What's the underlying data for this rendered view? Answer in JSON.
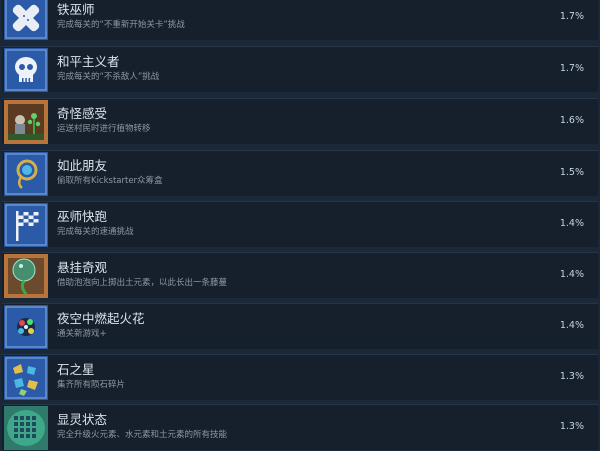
{
  "achievements": [
    {
      "title": "铁巫师",
      "desc": "完成每关的“不重新开始关卡”挑战",
      "pct": "1.7%",
      "icon": "crossed-bandage-icon"
    },
    {
      "title": "和平主义者",
      "desc": "完成每关的“不杀敌人”挑战",
      "pct": "1.7%",
      "icon": "skull-icon"
    },
    {
      "title": "奇怪感受",
      "desc": "运送村民时进行植物转移",
      "pct": "1.6%",
      "icon": "villager-plant-icon"
    },
    {
      "title": "如此朋友",
      "desc": "偷取所有Kickstarter众筹盒",
      "pct": "1.5%",
      "icon": "amulet-icon"
    },
    {
      "title": "巫师快跑",
      "desc": "完成每关的速通挑战",
      "pct": "1.4%",
      "icon": "checkered-flag-icon"
    },
    {
      "title": "悬挂奇观",
      "desc": "借助泡泡向上掷出土元素，以此长出一条藤蔓",
      "pct": "1.4%",
      "icon": "vine-bubble-icon"
    },
    {
      "title": "夜空中燃起火花",
      "desc": "通关新游戏+",
      "pct": "1.4%",
      "icon": "fireworks-icon"
    },
    {
      "title": "石之星",
      "desc": "集齐所有陨石碎片",
      "pct": "1.3%",
      "icon": "meteor-shards-icon"
    },
    {
      "title": "显灵状态",
      "desc": "完全升级火元素、水元素和土元素的所有技能",
      "pct": "1.3%",
      "icon": "spell-grid-icon"
    }
  ],
  "colors": {
    "page_bg": "#1b2838",
    "row_bg": "#16202d",
    "title": "#d9e4ea",
    "desc": "#8f98a0",
    "pct": "#c6d4df"
  }
}
